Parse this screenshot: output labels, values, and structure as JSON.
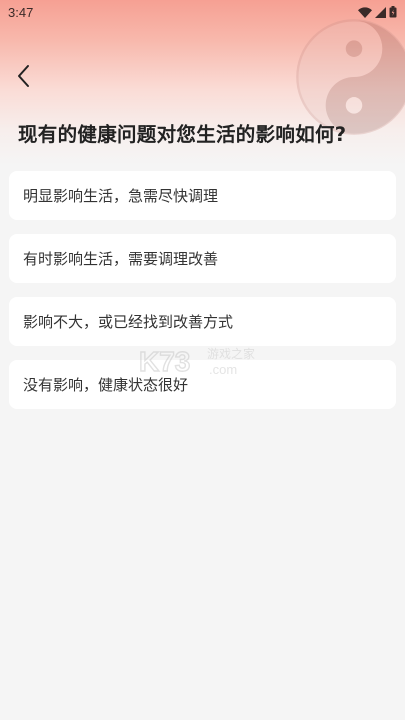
{
  "status_bar": {
    "time": "3:47",
    "icons": [
      "wifi-icon",
      "cellular-signal-icon",
      "battery-icon"
    ]
  },
  "header": {
    "back_icon": "chevron-left-icon",
    "decoration_icon": "yin-yang-icon"
  },
  "question": {
    "title": "现有的健康问题对您生活的影响如何?"
  },
  "options": [
    {
      "label": "明显影响生活，急需尽快调理"
    },
    {
      "label": "有时影响生活，需要调理改善"
    },
    {
      "label": "影响不大，或已经找到改善方式"
    },
    {
      "label": "没有影响，健康状态很好"
    }
  ],
  "watermark": {
    "brand": "K73",
    "site_cn": "游戏之家",
    "domain": ".com"
  },
  "colors": {
    "header_gradient_top": "#f6a093",
    "background": "#f5f5f5",
    "option_bg": "#ffffff",
    "text": "#333333"
  }
}
